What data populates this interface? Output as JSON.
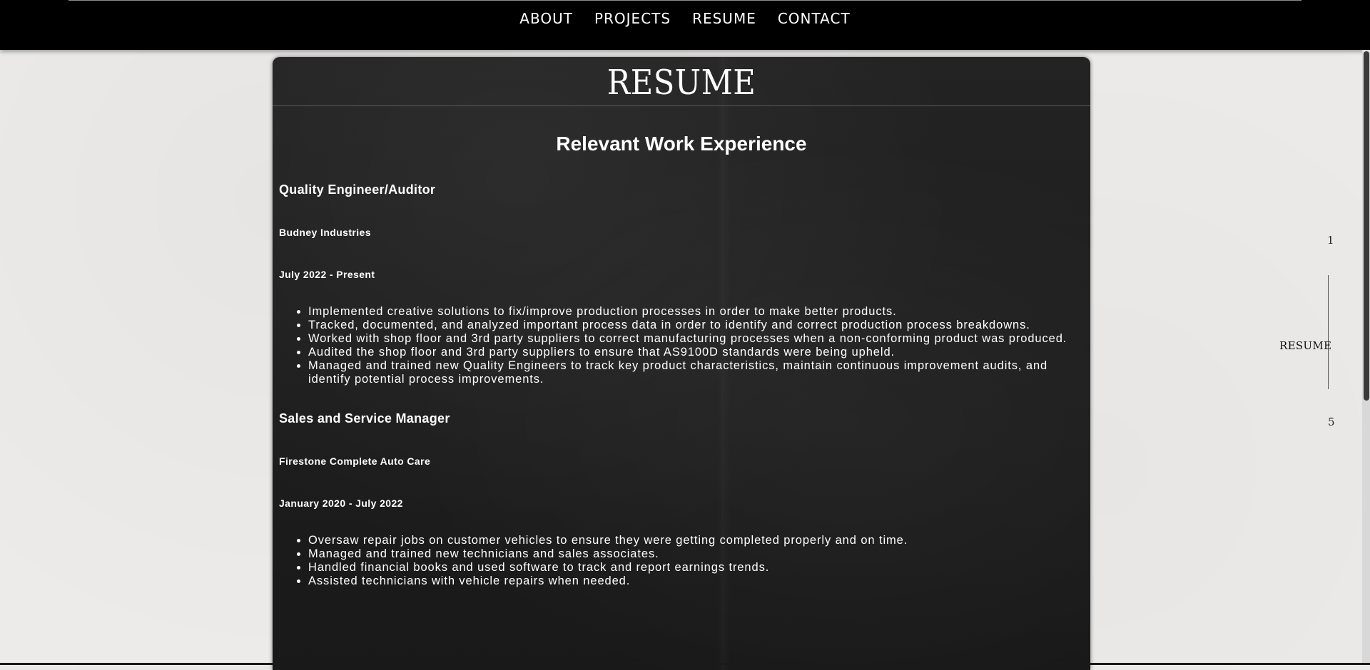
{
  "nav": {
    "links": [
      "ABOUT",
      "PROJECTS",
      "RESUME",
      "CONTACT"
    ]
  },
  "card": {
    "title": "RESUME",
    "section_heading": "Relevant Work Experience",
    "jobs": [
      {
        "title": "Quality Engineer/Auditor",
        "company": "Budney Industries",
        "dates": "July 2022 - Present",
        "bullets": [
          "Implemented creative solutions to fix/improve production processes in order to make better products.",
          "Tracked, documented, and analyzed important process data in order to identify and correct production process breakdowns.",
          "Worked with shop floor and 3rd party suppliers to correct manufacturing processes when a non-conforming product was produced.",
          "Audited the shop floor and 3rd party suppliers to ensure that AS9100D standards were being upheld.",
          "Managed and trained new Quality Engineers to track key product characteristics, maintain continuous improvement audits, and identify potential process improvements."
        ]
      },
      {
        "title": "Sales and Service Manager",
        "company": "Firestone Complete Auto Care",
        "dates": "January 2020 - July 2022",
        "bullets": [
          "Oversaw repair jobs on customer vehicles to ensure they were getting completed properly and on time.",
          "Managed and trained new technicians and sales associates.",
          "Handled financial books and used software to track and report earnings trends.",
          "Assisted technicians with vehicle repairs when needed."
        ]
      }
    ]
  },
  "side_nav": {
    "top_number": "1",
    "label": "RESUME",
    "bottom_number": "5"
  }
}
